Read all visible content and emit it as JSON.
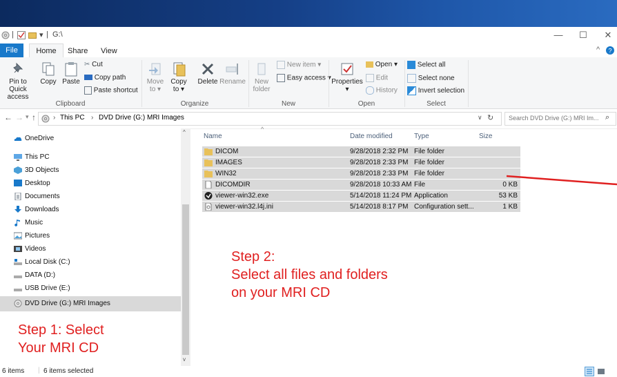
{
  "window": {
    "path": "G:\\",
    "controls": {
      "minimize": "—",
      "maximize": "☐",
      "close": "✕"
    }
  },
  "tabs": [
    "File",
    "Home",
    "Share",
    "View"
  ],
  "ribbon": {
    "clipboard": {
      "pin": [
        "Pin to Quick",
        "access"
      ],
      "copy": "Copy",
      "paste": "Paste",
      "cut": "Cut",
      "copy_path": "Copy path",
      "paste_shortcut": "Paste shortcut",
      "label": "Clipboard"
    },
    "organize": {
      "move_to": [
        "Move",
        "to ▾"
      ],
      "copy_to": [
        "Copy",
        "to ▾"
      ],
      "delete": "Delete",
      "rename": "Rename",
      "label": "Organize"
    },
    "new": {
      "new_folder": [
        "New",
        "folder"
      ],
      "new_item": "New item ▾",
      "easy_access": "Easy access ▾",
      "label": "New"
    },
    "open": {
      "properties": [
        "Properties",
        "▾"
      ],
      "open": "Open ▾",
      "edit": "Edit",
      "history": "History",
      "label": "Open"
    },
    "select": {
      "select_all": "Select all",
      "select_none": "Select none",
      "invert": "Invert selection",
      "label": "Select"
    }
  },
  "address": {
    "crumbs": [
      "This PC",
      "›",
      "DVD Drive (G:) MRI Images"
    ],
    "sep_first": "›",
    "search_placeholder": "Search DVD Drive (G:) MRI Im..."
  },
  "nav": [
    {
      "label": "OneDrive"
    },
    {
      "label": "This PC"
    },
    {
      "label": "3D Objects"
    },
    {
      "label": "Desktop"
    },
    {
      "label": "Documents"
    },
    {
      "label": "Downloads"
    },
    {
      "label": "Music"
    },
    {
      "label": "Pictures"
    },
    {
      "label": "Videos"
    },
    {
      "label": "Local Disk (C:)"
    },
    {
      "label": "DATA (D:)"
    },
    {
      "label": "USB Drive (E:)"
    },
    {
      "label": "DVD Drive (G:) MRI Images"
    }
  ],
  "columns": {
    "name": "Name",
    "date": "Date modified",
    "type": "Type",
    "size": "Size"
  },
  "files": [
    {
      "name": "DICOM",
      "date": "9/28/2018 2:32 PM",
      "type": "File folder",
      "size": "",
      "icon": "folder"
    },
    {
      "name": "IMAGES",
      "date": "9/28/2018 2:33 PM",
      "type": "File folder",
      "size": "",
      "icon": "folder"
    },
    {
      "name": "WIN32",
      "date": "9/28/2018 2:33 PM",
      "type": "File folder",
      "size": "",
      "icon": "folder"
    },
    {
      "name": "DICOMDIR",
      "date": "9/28/2018 10:33 AM",
      "type": "File",
      "size": "0 KB",
      "icon": "file"
    },
    {
      "name": "viewer-win32.exe",
      "date": "5/14/2018 11:24 PM",
      "type": "Application",
      "size": "53 KB",
      "icon": "app"
    },
    {
      "name": "viewer-win32.l4j.ini",
      "date": "5/14/2018 8:17 PM",
      "type": "Configuration sett...",
      "size": "1 KB",
      "icon": "ini"
    }
  ],
  "annotations": {
    "step1": [
      "Step 1: Select",
      "Your MRI CD"
    ],
    "step2": [
      "Step 2:",
      "Select all files and folders",
      "on your MRI CD"
    ]
  },
  "status": {
    "count": "6 items",
    "selected": "6 items selected"
  },
  "colors": {
    "annotation": "#e02020",
    "file_tab": "#1979ca",
    "selection": "#d9d9d9",
    "folder": "#e8c15a"
  }
}
